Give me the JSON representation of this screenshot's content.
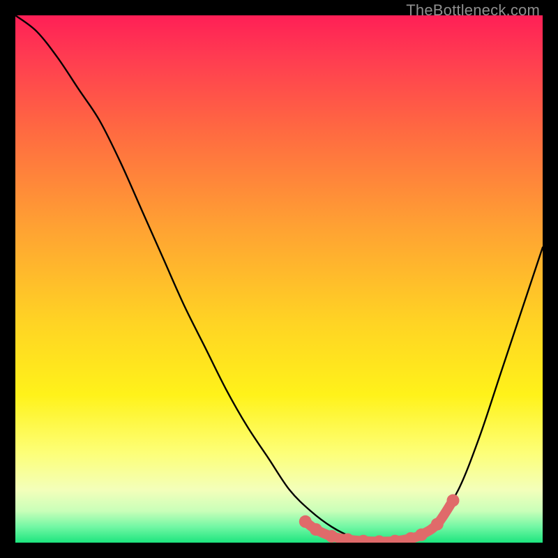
{
  "watermark": "TheBottleneck.com",
  "colors": {
    "curve": "#000000",
    "highlight": "#e06a6a",
    "background_top": "#ff1f56",
    "background_bottom": "#1de57e",
    "frame": "#000000"
  },
  "chart_data": {
    "type": "line",
    "title": "",
    "xlabel": "",
    "ylabel": "",
    "xlim": [
      0,
      100
    ],
    "ylim": [
      0,
      100
    ],
    "grid": false,
    "legend": false,
    "annotations": [],
    "series": [
      {
        "name": "bottleneck-curve",
        "color": "#000000",
        "x": [
          0,
          4,
          8,
          12,
          16,
          20,
          24,
          28,
          32,
          36,
          40,
          44,
          48,
          52,
          56,
          60,
          64,
          68,
          72,
          76,
          80,
          84,
          88,
          92,
          96,
          100
        ],
        "values": [
          100,
          97,
          92,
          86,
          80,
          72,
          63,
          54,
          45,
          37,
          29,
          22,
          16,
          10,
          6,
          3,
          1,
          0,
          0,
          1,
          4,
          10,
          20,
          32,
          44,
          56
        ]
      }
    ],
    "highlight_points": {
      "name": "optimal-range",
      "color": "#e06a6a",
      "x": [
        55,
        57,
        60,
        63,
        66,
        69,
        72,
        75,
        77,
        80,
        83
      ],
      "values": [
        4,
        2.5,
        1.2,
        0.6,
        0.3,
        0.2,
        0.3,
        0.8,
        1.5,
        3.5,
        8
      ]
    }
  }
}
